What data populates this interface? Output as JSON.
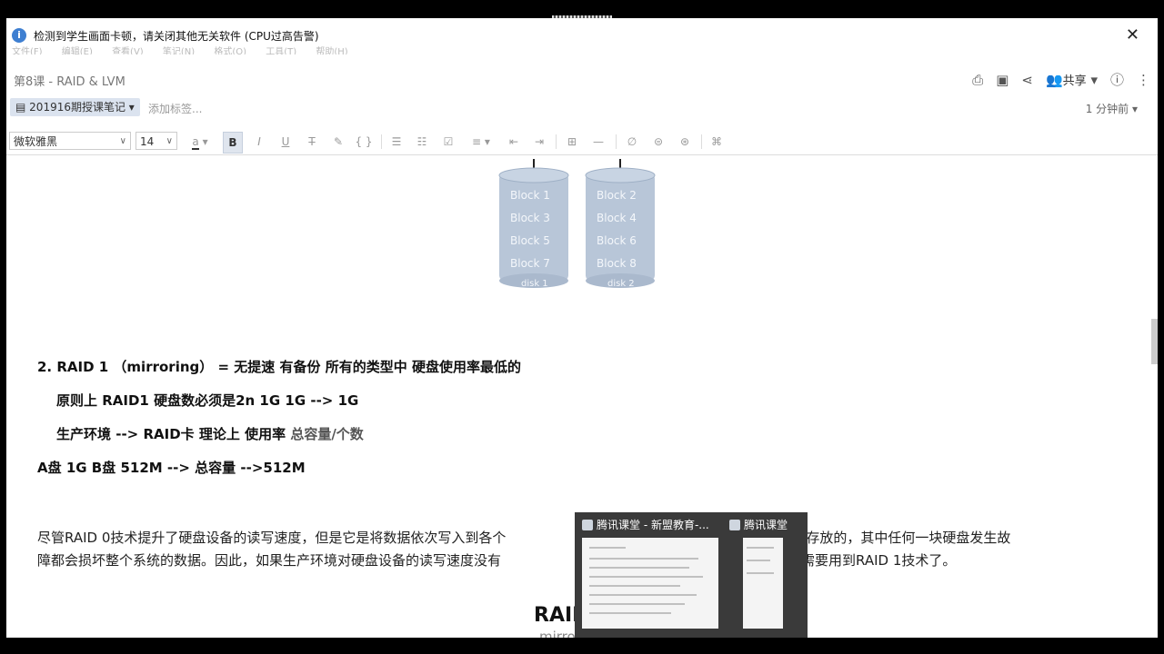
{
  "warning": {
    "icon": "i",
    "text": "检测到学生画面卡顿，请关闭其他无关软件 (CPU过高告警)"
  },
  "menu": [
    "文件(F)",
    "编辑(E)",
    "查看(V)",
    "笔记(N)",
    "格式(O)",
    "工具(T)",
    "帮助(H)"
  ],
  "document": {
    "title": "第8课 - RAID & LVM",
    "notebook": "201916期授课笔记",
    "add_tag": "添加标签...",
    "saved": "1 分钟前"
  },
  "header": {
    "share": "共享"
  },
  "toolbar": {
    "font": "微软雅黑",
    "size": "14",
    "bold": "B",
    "italic": "I",
    "underline": "U",
    "strike": "T",
    "code": "{ }"
  },
  "diagram": {
    "disk1": {
      "blocks": [
        "Block 1",
        "Block 3",
        "Block 5",
        "Block 7"
      ],
      "label": "disk 1"
    },
    "disk2": {
      "blocks": [
        "Block 2",
        "Block 4",
        "Block 6",
        "Block 8"
      ],
      "label": "disk 2"
    }
  },
  "content": {
    "line1": "2. RAID 1 （mirroring） = 无提速 有备份 所有的类型中  硬盘使用率最低的",
    "line2": "原则上 RAID1 硬盘数必须是2n    1G 1G --> 1G",
    "line3_a": "生产环境 --> RAID卡   理论上 使用率 ",
    "line3_b": "总容量/个数",
    "line4": "A盘  1G   B盘 512M --> 总容量 -->512M",
    "para1_a": "尽管RAID 0技术提升了硬盘设备的读写速度，但是它是将数据依次写入到各个",
    "para1_b": "据是分开存放的，其中任何一块硬盘发生故",
    "para2_a": "障都会损坏整个系统的数据。因此，如果生产环境对硬盘设备的读写速度没有",
    "para2_b": "性时，就需要用到RAID 1技术了。",
    "raid_label": "RAID",
    "mirroring_label": "mirro"
  },
  "taskbar_popup": {
    "item1": "腾讯课堂 - 新盟教育-...",
    "item2": "腾讯课堂"
  },
  "colors": {
    "disk": "#b8c6d8",
    "popup": "#3a3a3a",
    "notebook_bg": "#dbe3ef"
  }
}
